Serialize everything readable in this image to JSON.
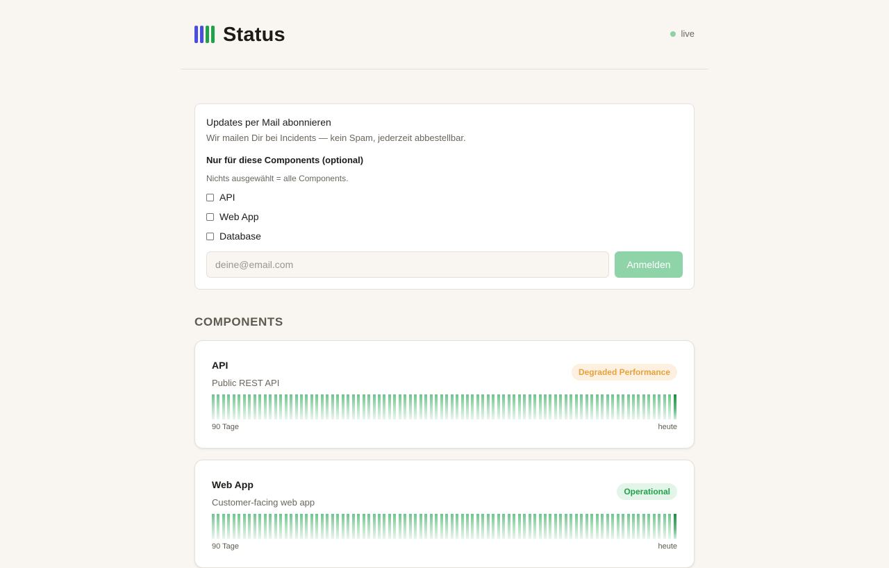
{
  "header": {
    "title": "Status",
    "live_label": "live",
    "logo_colors": [
      "#4a4ee0",
      "#4a4ee0",
      "#22a04b",
      "#22a04b"
    ],
    "live_color": "#8fd1a6"
  },
  "subscribe": {
    "title": "Updates per Mail abonnieren",
    "description": "Wir mailen Dir bei Incidents — kein Spam, jederzeit abbestellbar.",
    "components_label": "Nur für diese Components (optional)",
    "components_hint": "Nichts ausgewählt = alle Components.",
    "options": [
      {
        "label": "API",
        "checked": false
      },
      {
        "label": "Web App",
        "checked": false
      },
      {
        "label": "Database",
        "checked": false
      }
    ],
    "email_value": "",
    "email_placeholder": "deine@email.com",
    "submit_label": "Anmelden",
    "submit_color": "#8fd3a8"
  },
  "components": {
    "section_title": "COMPONENTS",
    "items": [
      {
        "name": "API",
        "description": "Public REST API",
        "status": "Degraded Performance",
        "status_color": "#e6a23c",
        "status_bg": "#fdf0e0",
        "bar_count": 90,
        "range_start_label": "90 Tage",
        "range_end_label": "heute"
      },
      {
        "name": "Web App",
        "description": "Customer-facing web app",
        "status": "Operational",
        "status_color": "#22a04b",
        "status_bg": "#e3f4e8",
        "bar_count": 90,
        "range_start_label": "90 Tage",
        "range_end_label": "heute"
      }
    ]
  }
}
